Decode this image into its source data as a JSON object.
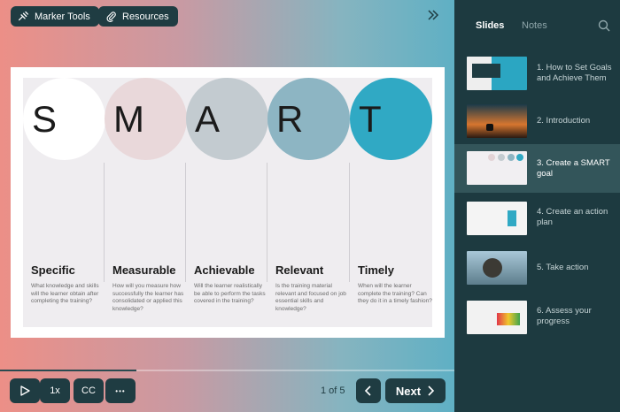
{
  "toolbar": {
    "marker_label": "Marker Tools",
    "resources_label": "Resources",
    "collapse_icon": "double-chevron-right-icon"
  },
  "slide": {
    "letters": [
      "S",
      "M",
      "A",
      "R",
      "T"
    ],
    "circle_colors": [
      "#ffffff",
      "#e9d8da",
      "#c3cbd0",
      "#8db5c3",
      "#30a9c4"
    ],
    "columns": [
      {
        "heading": "Specific",
        "text": "What knowledge and skills will the learner obtain after completing the training?"
      },
      {
        "heading": "Measurable",
        "text": "How will you measure how successfully the learner has consolidated or applied this knowledge?"
      },
      {
        "heading": "Achievable",
        "text": "Will the learner realistically be able to perform the tasks covered in the training?"
      },
      {
        "heading": "Relevant",
        "text": "Is the training material relevant and focused on job essential skills and knowledge?"
      },
      {
        "heading": "Timely",
        "text": "When will the learner complete the training? Can they do it in a timely fashion?"
      }
    ]
  },
  "player": {
    "progress": 0.3,
    "speed_label": "1x",
    "cc_label": "CC",
    "more_label": "•••",
    "page_count": "1 of 5",
    "next_label": "Next"
  },
  "sidebar": {
    "tab_slides": "Slides",
    "tab_notes": "Notes",
    "items": [
      {
        "label": "1. How to Set Goals and Achieve Them",
        "active": false
      },
      {
        "label": "2. Introduction",
        "active": false
      },
      {
        "label": "3. Create a SMART goal",
        "active": true
      },
      {
        "label": "4. Create an action plan",
        "active": false
      },
      {
        "label": "5. Take action",
        "active": false
      },
      {
        "label": "6. Assess your progress",
        "active": false
      }
    ]
  }
}
